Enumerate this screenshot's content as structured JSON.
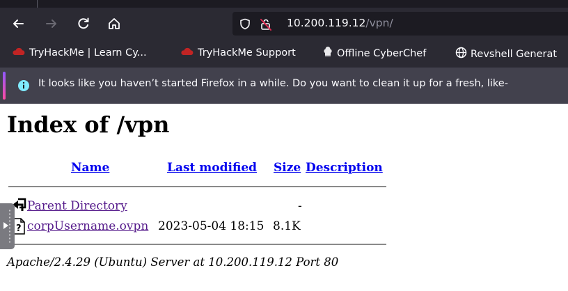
{
  "browser": {
    "nav": {
      "back_icon": "back-arrow-icon",
      "forward_icon": "forward-arrow-icon",
      "reload_icon": "reload-icon",
      "home_icon": "home-icon"
    },
    "urlbar": {
      "host": "10.200.119.12",
      "path": "/vpn/",
      "security_icon": "insecure-lock-icon",
      "tracking_icon": "shield-icon"
    },
    "bookmarks": [
      {
        "label": "TryHackMe | Learn Cy...",
        "icon": "tryhackme-icon"
      },
      {
        "label": "TryHackMe Support",
        "icon": "tryhackme-icon"
      },
      {
        "label": "Offline CyberChef",
        "icon": "chef-icon"
      },
      {
        "label": "Revshell Generat",
        "icon": "globe-icon"
      }
    ],
    "notification": {
      "icon": "info-icon",
      "message": "It looks like you haven’t started Firefox in a while. Do you want to clean it up for a fresh, like-"
    }
  },
  "page": {
    "title": "Index of /vpn",
    "columns": {
      "name": "Name",
      "last_modified": "Last modified",
      "size": "Size",
      "description": "Description"
    },
    "rows": [
      {
        "name": "Parent Directory",
        "last_modified": "",
        "size": "-",
        "icon": "back-folder-icon"
      },
      {
        "name": "corpUsername.ovpn",
        "last_modified": "2023-05-04 18:15",
        "size": "8.1K",
        "icon": "unknown-file-icon"
      }
    ],
    "address": "Apache/2.4.29 (Ubuntu) Server at 10.200.119.12 Port 80"
  },
  "colors": {
    "toolbar": "#2b2a33",
    "notification": "#42414d",
    "link": "#0000ee",
    "visited_link": "#551a8b",
    "insecure": "#e22850"
  }
}
